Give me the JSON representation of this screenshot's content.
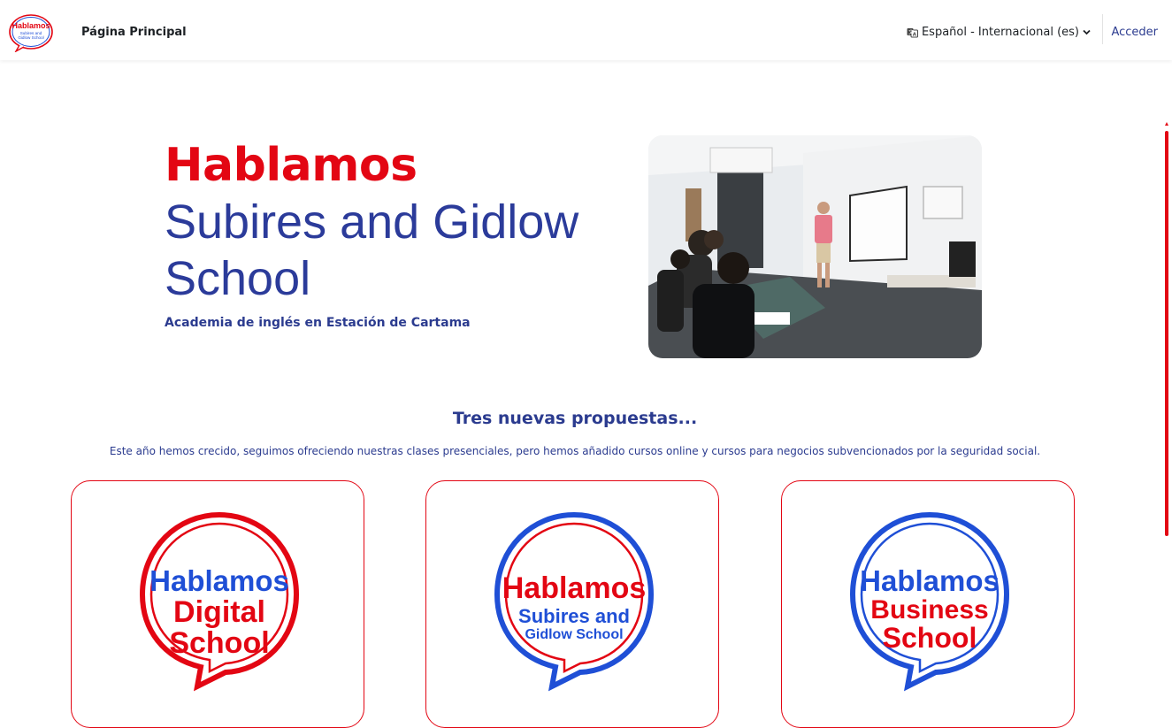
{
  "nav": {
    "logo": {
      "line1": "Hablamos",
      "line2": "Subires and",
      "line3": "Gidlow School"
    },
    "home": "Página Principal",
    "language": "Español - Internacional (es)",
    "login": "Acceder"
  },
  "hero": {
    "title": "Hablamos",
    "subtitle": "Subires and Gidlow School",
    "tagline": "Academia de inglés en Estación de Cartama"
  },
  "proposals": {
    "title": "Tres nuevas propuestas...",
    "description": "Este año hemos crecido, seguimos ofreciendo nuestras clases presenciales, pero hemos añadido cursos online y cursos para negocios subvencionados por la seguridad social.",
    "cards": [
      {
        "line1": "Hablamos",
        "line2": "Digital",
        "line3": "School"
      },
      {
        "line1": "Hablamos",
        "line2": "Subires and",
        "line3": "Gidlow School"
      },
      {
        "line1": "Hablamos",
        "line2": "Business",
        "line3": "School"
      }
    ]
  },
  "colors": {
    "red": "#e30613",
    "blue": "#1f4fd6",
    "navy": "#2b3b8f"
  }
}
